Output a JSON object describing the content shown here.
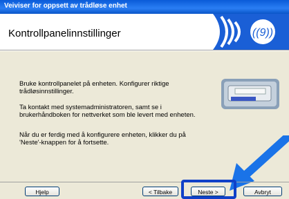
{
  "window": {
    "title": "Veiviser for oppsett av trådløse enhet"
  },
  "header": {
    "title": "Kontrollpanelinnstillinger"
  },
  "body": {
    "paragraph1": "Bruke kontrollpanelet på enheten. Konfigurer riktige\ntrådløsinnstillinger.",
    "paragraph2": "Ta kontakt med systemadministratoren, samt se i\nbrukerhåndboken for nettverket som ble levert med enheten.",
    "paragraph3": "Når du er ferdig med å konfigurere enheten, klikker du på\n'Neste'-knappen for å fortsette."
  },
  "buttons": {
    "help": "Hjelp",
    "back": "< Tilbake",
    "next": "Neste >",
    "cancel": "Avbryt"
  },
  "icons": {
    "header_logo": "wireless-waves-icon",
    "printer": "printer-control-panel-icon",
    "pointer": "blue-arrow-icon"
  },
  "colors": {
    "title_bar": "#0a5bd8",
    "highlight": "#1040c8",
    "arrow": "#1a73e8"
  }
}
